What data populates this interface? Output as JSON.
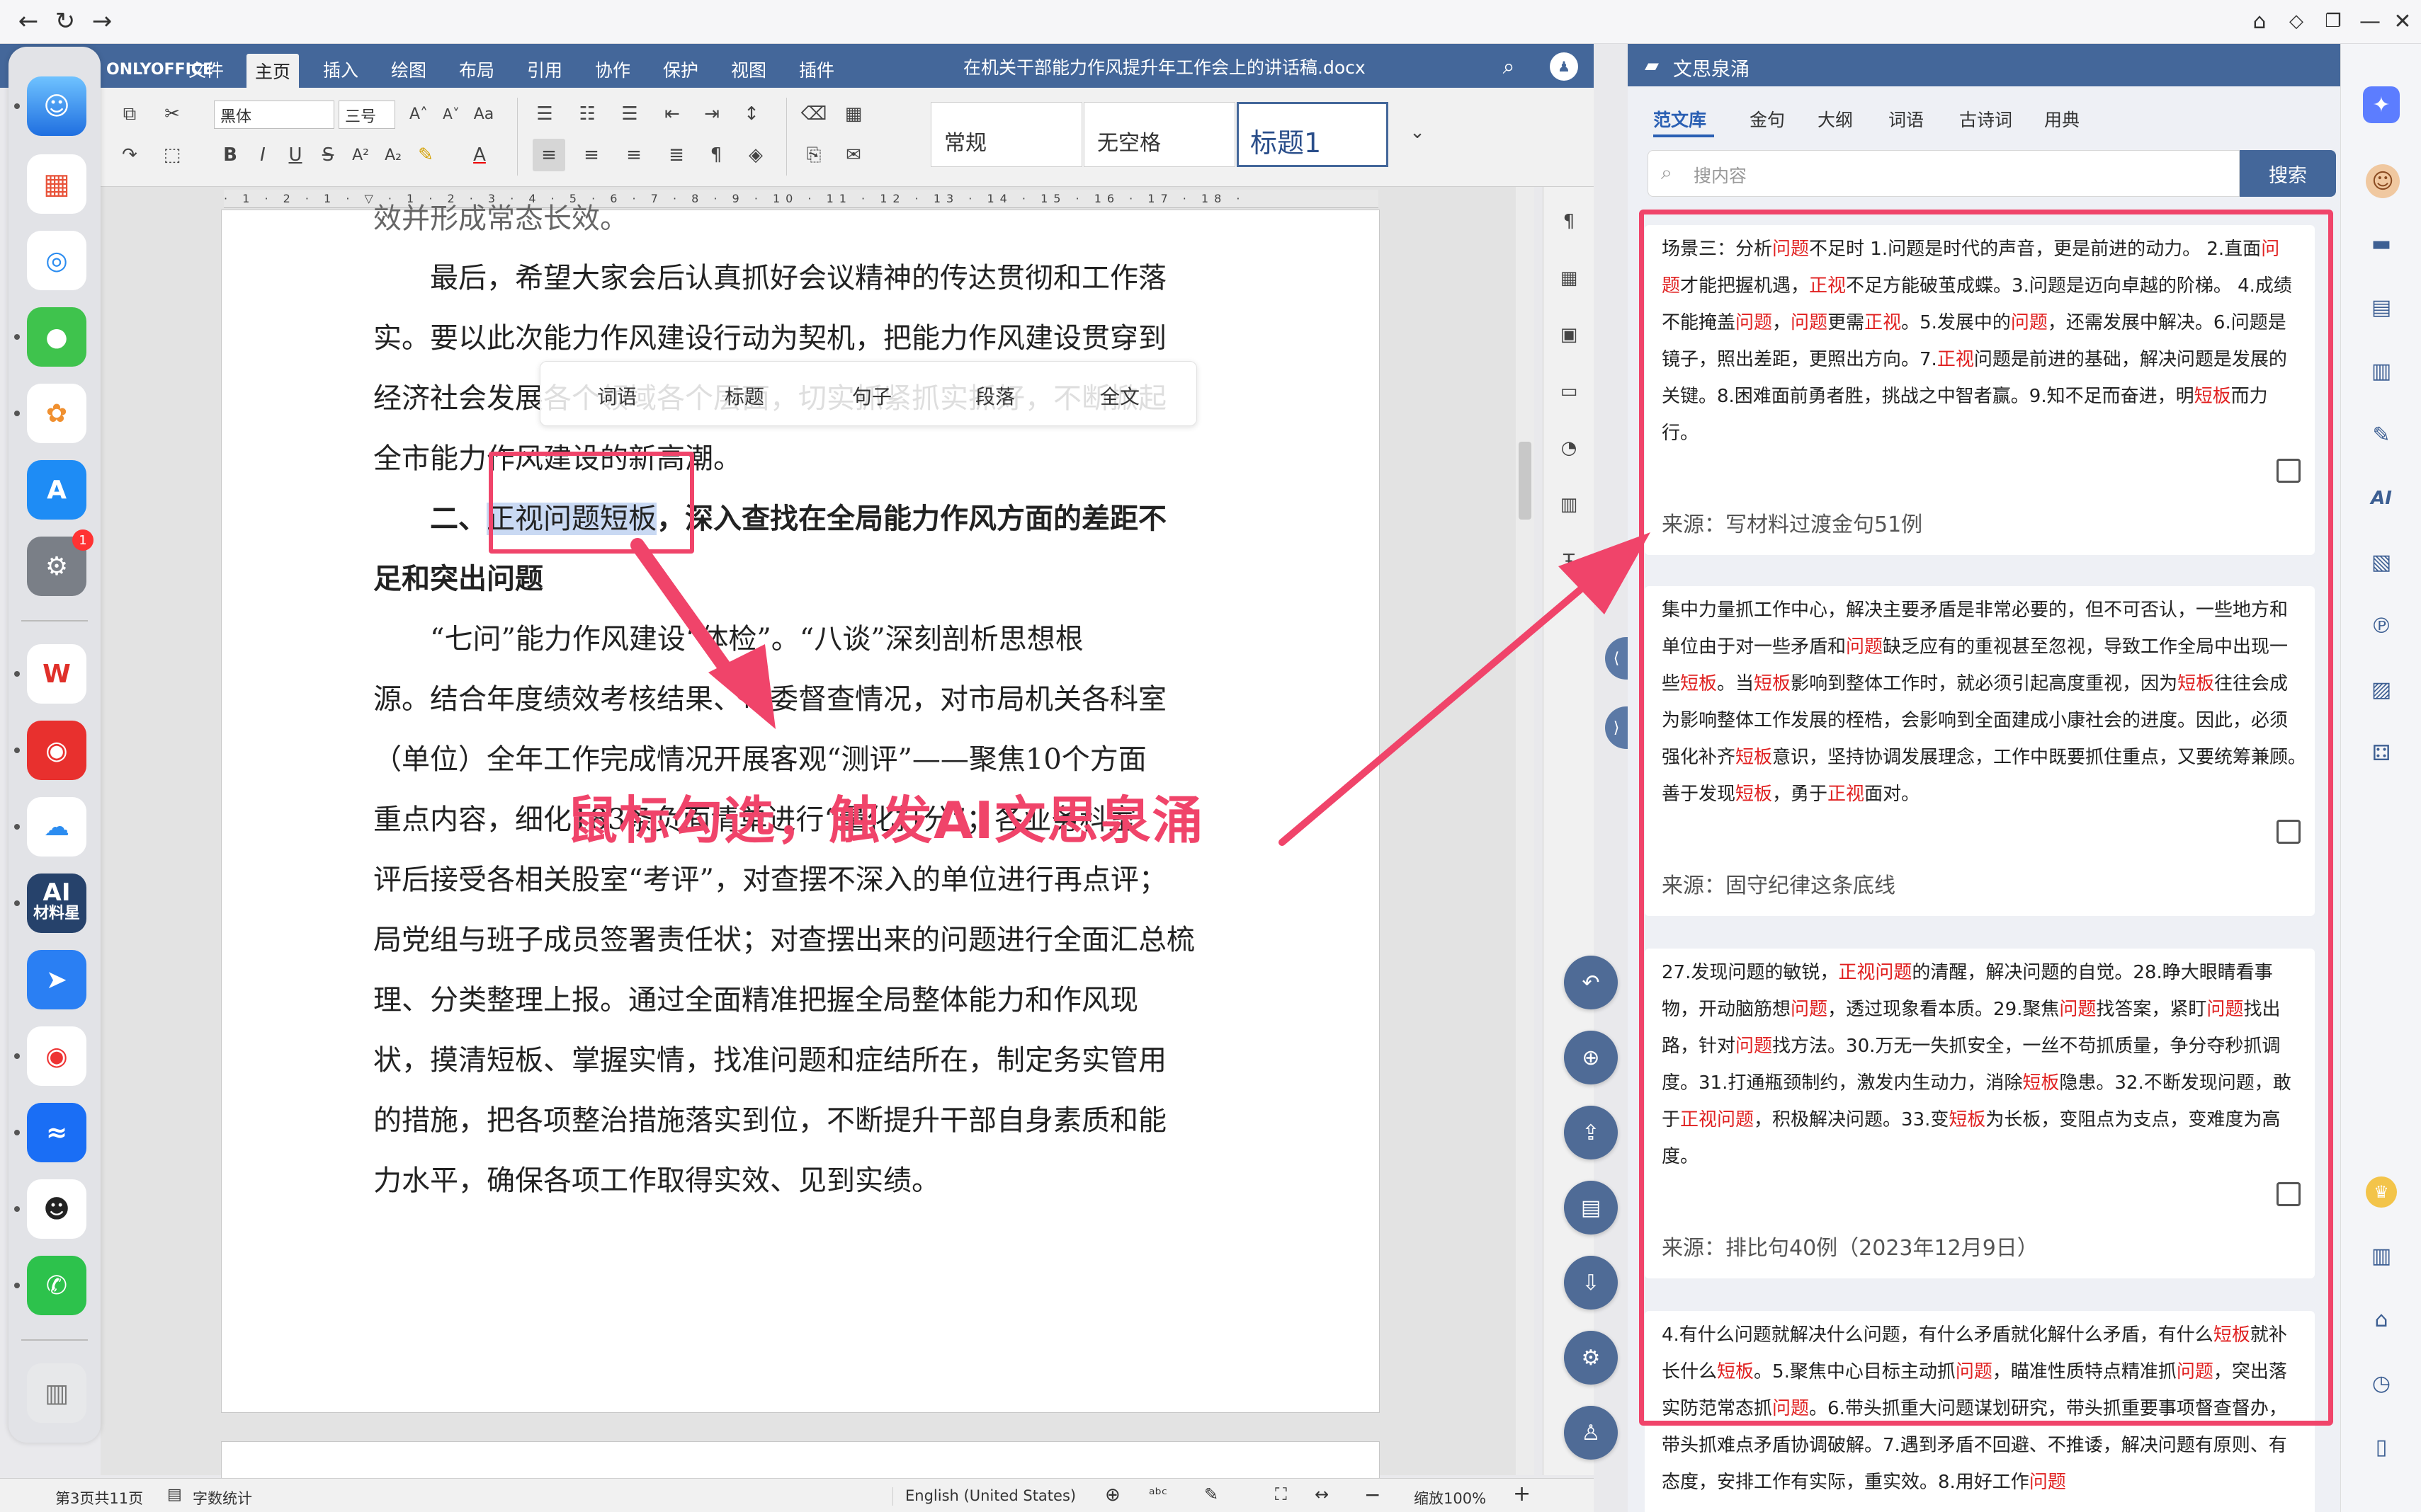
{
  "browser": {
    "back": "←",
    "reload": "↻",
    "forward": "→"
  },
  "app": {
    "logo": "ONLYOFFICE",
    "menus": [
      "文件",
      "主页",
      "插入",
      "绘图",
      "布局",
      "引用",
      "协作",
      "保护",
      "视图",
      "插件"
    ],
    "active_menu": "主页",
    "doc_title": "在机关干部能力作风提升年工作会上的讲话稿.docx"
  },
  "toolbar": {
    "font_name": "黑体",
    "font_size": "三号",
    "styles": [
      "常规",
      "无空格",
      "标题1"
    ]
  },
  "document": {
    "paragraphs": [
      "效并形成常态长效。",
      "　　最后，希望大家会后认真抓好会议精神的传达贯彻和工作落",
      "实。要以此次能力作风建设行动为契机，把能力作风建设贯穿到",
      "经济社会发展各个领域各个层面，切实抓紧抓实抓好，不断掀起",
      "全市能力作风建设的新高潮。"
    ],
    "heading_prefix": "　　二、",
    "heading_selected": "正视问题短板",
    "heading_rest": "，深入查找在全局能力作风方面的差距不",
    "heading_line2": "足和突出问题",
    "body": [
      "　　“七问”能力作风建设“体检”。“八谈”深刻剖析思想根",
      "源。结合年度绩效考核结果、市委督查情况，对市局机关各科室",
      "（单位）全年工作完成情况开展客观“测评”——聚焦10个方面",
      "重点内容，细化183条负面清单进行“量化打分”；各业务科室",
      "评后接受各相关股室“考评”，对查摆不深入的单位进行再点评；",
      "局党组与班子成员签署责任状；对查摆出来的问题进行全面汇总梳",
      "理、分类整理上报。通过全面精准把握全局整体能力和作风现",
      "状，摸清短板、掌握实情，找准问题和症结所在，制定务实管用",
      "的措施，把各项整治措施落实到位，不断提升干部自身素质和能",
      "力水平，确保各项工作取得实效、见到实绩。"
    ]
  },
  "popup": {
    "items": [
      "词语",
      "标题",
      "句子",
      "段落",
      "全文"
    ]
  },
  "annotation": {
    "caption": "鼠标勾选，触发AI文思泉涌"
  },
  "status": {
    "page": "第3页共11页",
    "wordcount": "字数统计",
    "language": "English (United States)",
    "zoom": "缩放100%"
  },
  "panel": {
    "title": "文思泉涌",
    "tabs": [
      "范文库",
      "金句",
      "大纲",
      "词语",
      "古诗词",
      "用典"
    ],
    "active_tab": "范文库",
    "search_placeholder": "搜内容",
    "search_button": "搜索",
    "cards": [
      {
        "html": "场景三：分析<span class='hl'>问题</span>不足时 1.问题是时代的声音，更是前进的动力。 2.直面<span class='hl'>问题</span>才能把握机遇，<span class='hl'>正视</span>不足方能破茧成蝶。3.问题是迈向卓越的阶梯。 4.成绩不能掩盖<span class='hl'>问题</span>，<span class='hl'>问题</span>更需<span class='hl'>正视</span>。5.发展中的<span class='hl'>问题</span>，还需发展中解决。6.问题是镜子，照出差距，更照出方向。7.<span class='hl'>正视</span>问题是前进的基础，解决问题是发展的关键。8.困难面前勇者胜，挑战之中智者赢。9.知不足而奋进，明<span class='hl'>短板</span>而力行。",
        "source": "来源：写材料过渡金句51例"
      },
      {
        "html": "集中力量抓工作中心，解决主要矛盾是非常必要的，但不可否认，一些地方和单位由于对一些矛盾和<span class='hl'>问题</span>缺乏应有的重视甚至忽视，导致工作全局中出现一些<span class='hl'>短板</span>。当<span class='hl'>短板</span>影响到整体工作时，就必须引起高度重视，因为<span class='hl'>短板</span>往往会成为影响整体工作发展的桎梏，会影响到全面建成小康社会的进度。因此，必须强化补齐<span class='hl'>短板</span>意识，坚持协调发展理念，工作中既要抓住重点，又要统筹兼顾。　善于发现<span class='hl'>短板</span>，勇于<span class='hl'>正视</span>面对。",
        "source": "来源：固守纪律这条底线"
      },
      {
        "html": "27.发现问题的敏锐，<span class='hl'>正视问题</span>的清醒，解决问题的自觉。28.睁大眼睛看事物，开动脑筋想<span class='hl'>问题</span>，透过现象看本质。29.聚焦<span class='hl'>问题</span>找答案，紧盯<span class='hl'>问题</span>找出路，针对<span class='hl'>问题</span>找方法。30.万无一失抓安全，一丝不苟抓质量，争分夺秒抓调度。31.打通瓶颈制约，激发内生动力，消除<span class='hl'>短板</span>隐患。32.不断发现问题，敢于<span class='hl'>正视问题</span>，积极解决问题。33.变<span class='hl'>短板</span>为长板，变阻点为支点，变难度为高度。",
        "source": "来源：排比句40例（2023年12月9日）"
      },
      {
        "html": "4.有什么问题就解决什么问题，有什么矛盾就化解什么矛盾，有什么<span class='hl'>短板</span>就补长什么<span class='hl'>短板</span>。5.聚焦中心目标主动抓<span class='hl'>问题</span>，瞄准性质特点精准抓<span class='hl'>问题</span>，突出落实防范常态抓<span class='hl'>问题</span>。6.带头抓重大问题谋划研究，带头抓重要事项督查督办，带头抓难点矛盾协调破解。7.遇到矛盾不回避、不推诿，解决问题有原则、有态度，安排工作有实际，重实效。8.用好工作<span class='hl'>问题</span>",
        "source": ""
      }
    ]
  }
}
